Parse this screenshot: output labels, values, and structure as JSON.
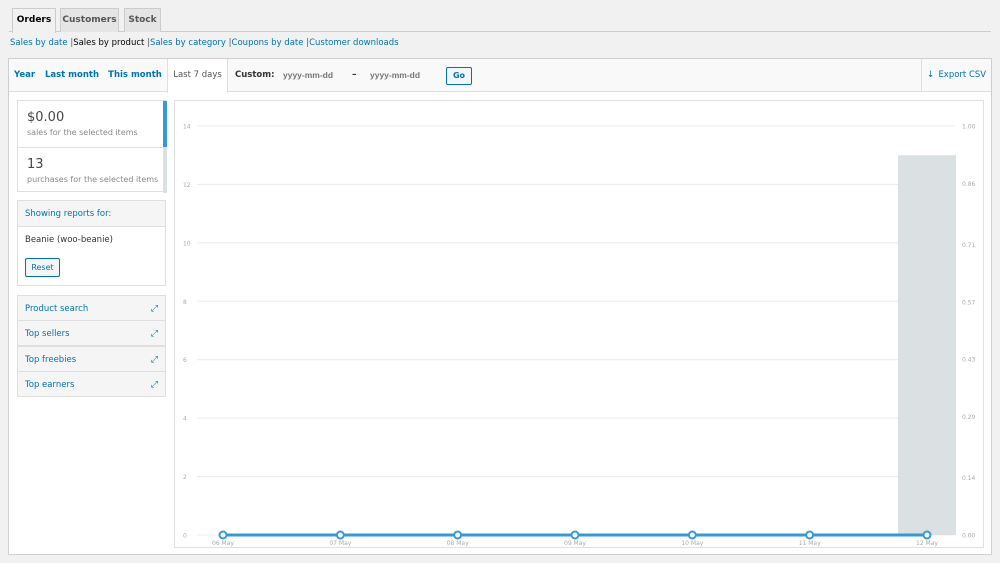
{
  "tabs": [
    {
      "label": "Orders",
      "active": true
    },
    {
      "label": "Customers",
      "active": false
    },
    {
      "label": "Stock",
      "active": false
    }
  ],
  "subnav": {
    "items": [
      "Sales by date",
      "Sales by product",
      "Sales by category",
      "Coupons by date",
      "Customer downloads"
    ],
    "current": "Sales by product",
    "separator": "|"
  },
  "ranges": [
    {
      "label": "Year",
      "active": false
    },
    {
      "label": "Last month",
      "active": false
    },
    {
      "label": "This month",
      "active": false
    },
    {
      "label": "Last 7 days",
      "active": true
    }
  ],
  "custom": {
    "label": "Custom:",
    "start_placeholder": "yyyy-mm-dd",
    "end_placeholder": "yyyy-mm-dd",
    "dash": "–",
    "go_label": "Go"
  },
  "export": {
    "label": "Export CSV",
    "icon": "download-arrow-icon"
  },
  "legend": [
    {
      "value": "$0.00",
      "label": "sales for the selected items",
      "color": "#3498db"
    },
    {
      "value": "13",
      "label": "purchases for the selected items",
      "color": "#dbe1e3"
    }
  ],
  "report_for": {
    "title": "Showing reports for:",
    "product": "Beanie (woo-beanie)",
    "reset_label": "Reset"
  },
  "sections": [
    {
      "label": "Product search",
      "icon": "expand-icon"
    },
    {
      "label": "Top sellers",
      "icon": "expand-icon"
    },
    {
      "label": "Top freebies",
      "icon": "expand-icon"
    },
    {
      "label": "Top earners",
      "icon": "expand-icon"
    }
  ],
  "chart_data": {
    "type": "bar",
    "categories": [
      "06 May",
      "07 May",
      "08 May",
      "09 May",
      "10 May",
      "11 May",
      "12 May"
    ],
    "series": [
      {
        "type": "bar",
        "axis": "left",
        "values": [
          0,
          0,
          0,
          0,
          0,
          0,
          13
        ],
        "color": "#dbe1e3"
      },
      {
        "type": "line",
        "axis": "right",
        "values": [
          0,
          0,
          0,
          0,
          0,
          0,
          0
        ],
        "color": "#3498db"
      }
    ],
    "ylim_left": [
      0,
      14
    ],
    "yticks_left": [
      "0",
      "2",
      "4",
      "6",
      "8",
      "10",
      "12",
      "14"
    ],
    "ylim_right": [
      0,
      1
    ],
    "yticks_right": [
      "0.00",
      "0.14",
      "0.29",
      "0.43",
      "0.57",
      "0.71",
      "0.86",
      "1.00"
    ],
    "grid": true
  }
}
